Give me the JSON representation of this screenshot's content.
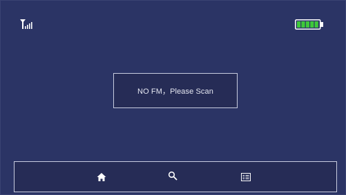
{
  "status_bar": {
    "signal_icon": "signal-antenna-icon",
    "battery_icon": "battery-full-icon",
    "battery_level": 1.0,
    "battery_color": "#3ec93a"
  },
  "message": {
    "text": "NO FM，Please Scan"
  },
  "nav": {
    "items": [
      {
        "icon": "home-icon"
      },
      {
        "icon": "search-icon"
      },
      {
        "icon": "channel-list-icon"
      }
    ]
  },
  "colors": {
    "background": "#2b3465",
    "panel": "#262c56",
    "border": "#c9cde0",
    "text": "#e6e8f2"
  }
}
